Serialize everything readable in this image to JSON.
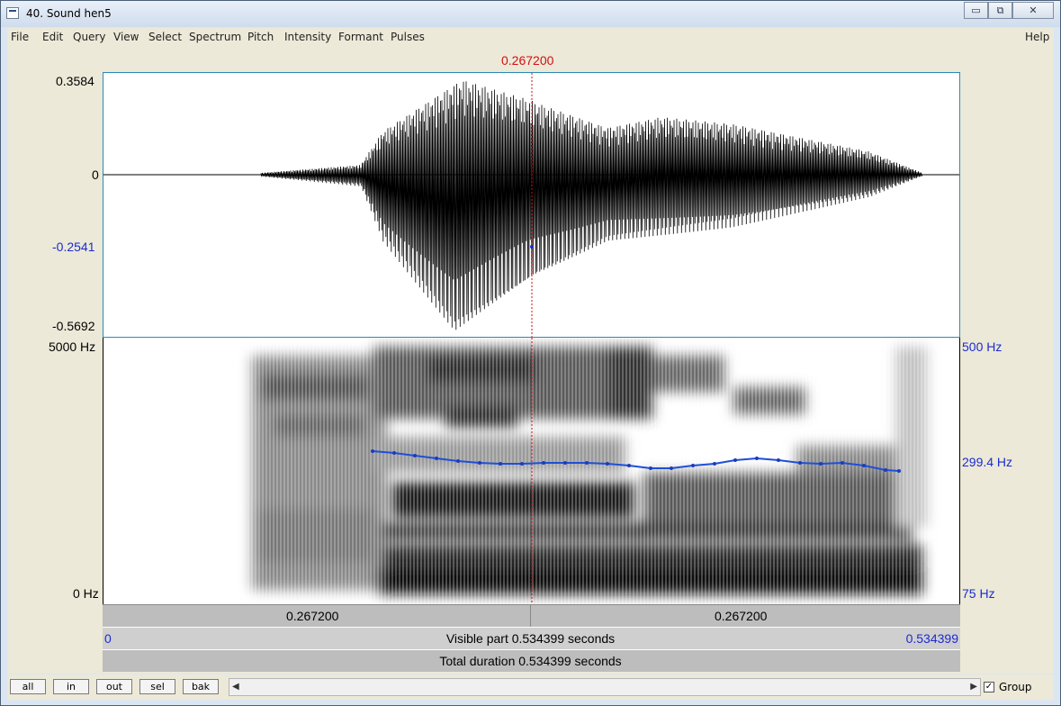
{
  "window": {
    "title": "40. Sound hen5",
    "minimize": "▭",
    "restore": "⧉",
    "close": "✕"
  },
  "menu": [
    "File",
    "Edit",
    "Query",
    "View",
    "Select",
    "Spectrum",
    "Pitch",
    "Intensity",
    "Formant",
    "Pulses"
  ],
  "help": "Help",
  "cursor_time": "0.267200",
  "waveform": {
    "y_max": "0.3584",
    "y_zero": "0",
    "y_cursor": "-0.2541",
    "y_min": "-0.5692"
  },
  "spectrogram": {
    "freq_top": "5000 Hz",
    "freq_bottom": "0 Hz"
  },
  "pitch": {
    "top": "500 Hz",
    "cursor": "299.4 Hz",
    "bottom": "75 Hz"
  },
  "time_axis": {
    "left_label": "0.267200",
    "right_label": "0.267200"
  },
  "visible": {
    "start": "0",
    "label": "Visible part 0.534399 seconds",
    "end": "0.534399"
  },
  "total": {
    "label": "Total duration 0.534399 seconds"
  },
  "buttons": {
    "all": "all",
    "in": "in",
    "out": "out",
    "sel": "sel",
    "bak": "bak"
  },
  "group": {
    "label": "Group",
    "checked": true,
    "mark": "✓"
  },
  "scroll": {
    "left": "◀",
    "right": "▶"
  },
  "colors": {
    "cursor": "#d01010",
    "pitch": "#1f4fd6",
    "axis_blue": "#1c2bd0"
  }
}
